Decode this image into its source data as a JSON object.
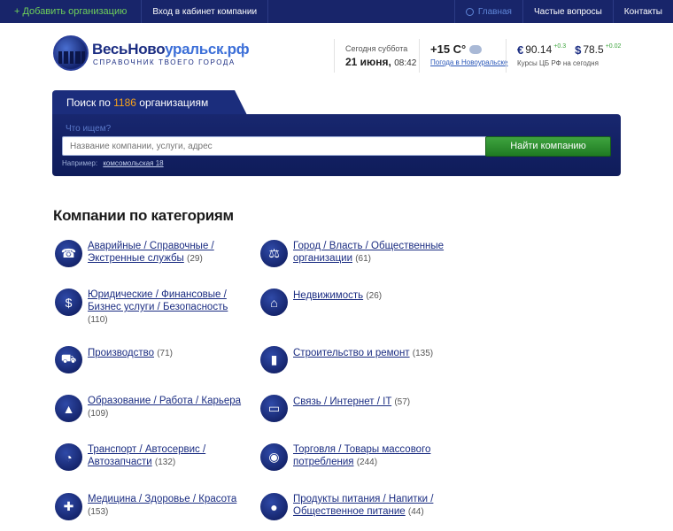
{
  "topbar": {
    "add_org": "+ Добавить организацию",
    "company_login": "Вход в кабинет компании",
    "home": "Главная",
    "faq": "Частые вопросы",
    "contacts": "Контакты"
  },
  "logo": {
    "name_part1": "ВесьНово",
    "name_part2": "уральск.рф",
    "tagline": "СПРАВОЧНИК ТВОЕГО ГОРОДА"
  },
  "date": {
    "label": "Сегодня суббота",
    "day": "21 июня,",
    "time": "08:42"
  },
  "weather": {
    "temp": "+15 C°",
    "link": "Погода в Новоуральске"
  },
  "rates": {
    "eur_symbol": "€",
    "eur_value": "90.14",
    "eur_delta": "+0.3",
    "usd_symbol": "$",
    "usd_value": "78.5",
    "usd_delta": "+0.02",
    "note": "Курсы ЦБ РФ на сегодня"
  },
  "search": {
    "tab_prefix": "Поиск по",
    "tab_count": "1186",
    "tab_suffix": "организациям",
    "hint": "Что ищем?",
    "placeholder": "Название компании, услуги, адрес",
    "button": "Найти компанию",
    "example_label": "Например:",
    "example_value": "комсомольская 18"
  },
  "section_title": "Компании по категориям",
  "categories": [
    {
      "line1": "Аварийные / Справочные /",
      "line2": "Экстренные службы",
      "count": "(29)",
      "icon": "phone-icon"
    },
    {
      "line1": "Город / Власть / Общественные",
      "line2": "организации",
      "count": "(61)",
      "icon": "scales-icon"
    },
    {
      "line1": "Юридические / Финансовые /",
      "line2": "Бизнес услуги / Безопасность",
      "count": "(110)",
      "icon": "money-icon"
    },
    {
      "line1": "Недвижимость",
      "line2": "",
      "count": "(26)",
      "icon": "house-icon"
    },
    {
      "line1": "Производство",
      "line2": "",
      "count": "(71)",
      "icon": "truck-icon"
    },
    {
      "line1": "Строительство и ремонт",
      "line2": "",
      "count": "(135)",
      "icon": "paint-roller-icon"
    },
    {
      "line1": "Образование / Работа / Карьера",
      "line2": "",
      "count": "(109)",
      "icon": "graduation-cap-icon"
    },
    {
      "line1": "Связь / Интернет / IT",
      "line2": "",
      "count": "(57)",
      "icon": "laptop-icon"
    },
    {
      "line1": "Транспорт / Автосервис /",
      "line2": "Автозапчасти",
      "count": "(132)",
      "icon": "speedometer-icon"
    },
    {
      "line1": "Торговля / Товары массового",
      "line2": "потребления",
      "count": "(244)",
      "icon": "cart-icon"
    },
    {
      "line1": "Медицина / Здоровье / Красота",
      "line2": "",
      "count": "(153)",
      "icon": "first-aid-icon"
    },
    {
      "line1": "Продукты питания / Напитки /",
      "line2": "Общественное питание",
      "count": "(44)",
      "icon": "apple-icon"
    }
  ]
}
